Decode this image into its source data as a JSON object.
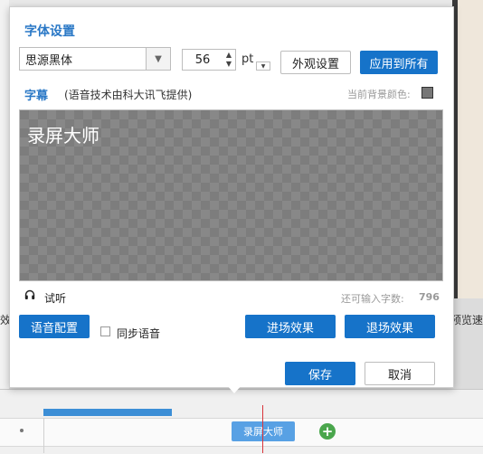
{
  "background": {
    "side_text_left": "效",
    "side_text_right": "预览速",
    "clip_label": "录屏大师",
    "add_symbol": "+"
  },
  "dialog": {
    "title": "字体设置",
    "font_select": {
      "value": "思源黑体"
    },
    "font_size": {
      "value": "56"
    },
    "unit": "pt",
    "appearance_button": "外观设置",
    "apply_all_button": "应用到所有",
    "subtitle_label": "字幕",
    "subtitle_note": "(语音技术由科大讯飞提供)",
    "bg_color_label": "当前背景颜色:",
    "bg_color": "#777777",
    "preview_text": "录屏大师",
    "listen_label": "试听",
    "remaining_label": "还可输入字数:",
    "remaining_count": "796",
    "voice_config_button": "语音配置",
    "sync_voice_label": "同步语音",
    "enter_effect_button": "进场效果",
    "exit_effect_button": "退场效果",
    "save_button": "保存",
    "cancel_button": "取消"
  },
  "colors": {
    "accent": "#1673c9",
    "title_blue": "#2a78c6"
  }
}
